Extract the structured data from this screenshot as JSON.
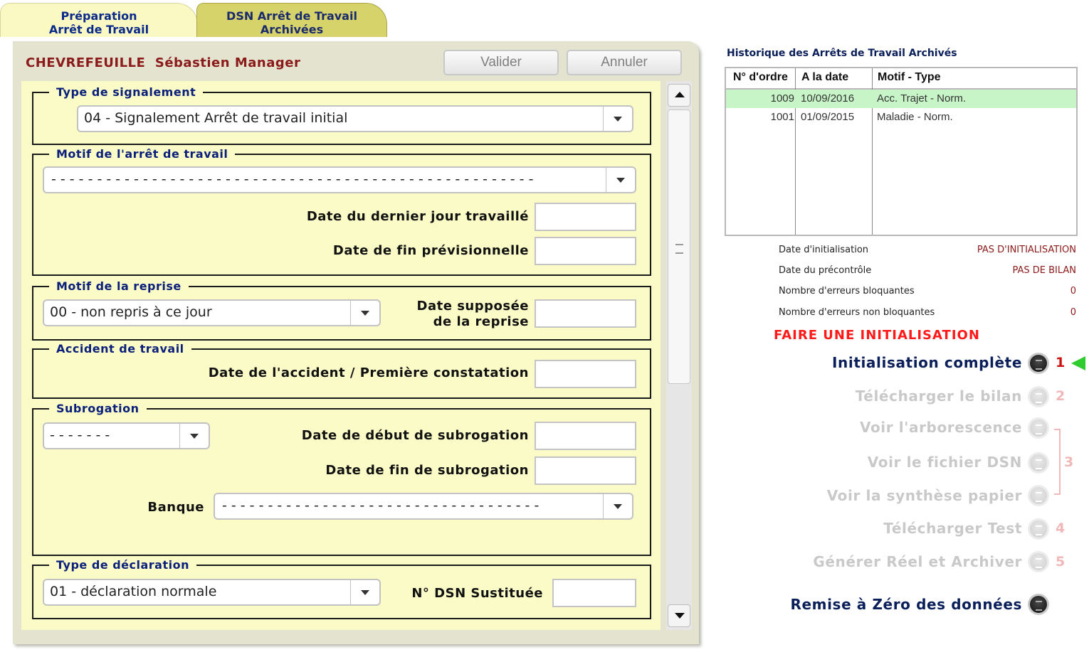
{
  "tabs": [
    {
      "line1": "Préparation",
      "line2": "Arrêt de Travail"
    },
    {
      "line1": "DSN Arrêt de Travail",
      "line2": "Archivées"
    }
  ],
  "employee": {
    "last_name": "CHEVREFEUILLE",
    "first_name": "Sébastien Manager"
  },
  "buttons": {
    "validate": "Valider",
    "cancel": "Annuler"
  },
  "sections": {
    "type_signalement": {
      "legend": "Type de signalement",
      "value": "04 - Signalement Arrêt de travail initial"
    },
    "motif_arret": {
      "legend": "Motif de l'arrêt de travail",
      "value": "- - - - - - - - - - - - - - - - - - - - - - - - - - - - - - - - - - - - - - - - - - - - - - - - - - - - -",
      "date_dernier_jour": "Date du dernier jour travaillé",
      "date_fin_prev": "Date de fin prévisionnelle"
    },
    "motif_reprise": {
      "legend": "Motif de la reprise",
      "value": "00 - non repris à ce jour",
      "date_supposee_1": "Date supposée",
      "date_supposee_2": "de la reprise"
    },
    "accident": {
      "legend": "Accident de travail",
      "date_label": "Date de l'accident / Première constatation"
    },
    "subrogation": {
      "legend": "Subrogation",
      "value": "- - - - - - -",
      "date_debut": "Date de début de subrogation",
      "date_fin": "Date de fin de subrogation",
      "banque": "Banque",
      "banque_value": "- - - - - - - - - - - - - - - - - - - - - - - - - - - - - - - - - - -"
    },
    "type_declaration": {
      "legend": "Type de déclaration",
      "value": "01 - déclaration normale",
      "dsn_label": "N° DSN Sustituée"
    }
  },
  "history": {
    "title": "Historique des Arrêts de Travail Archivés",
    "columns": [
      "N° d'ordre",
      "A la date",
      "Motif - Type"
    ],
    "rows": [
      {
        "num": "1009",
        "date": "10/09/2016",
        "motif": "Acc. Trajet - Norm.",
        "selected": true
      },
      {
        "num": "1001",
        "date": "01/09/2015",
        "motif": "Maladie - Norm.",
        "selected": false
      }
    ]
  },
  "status": [
    {
      "label": "Date d'initialisation",
      "value": "PAS D'INITIALISATION"
    },
    {
      "label": "Date du précontrôle",
      "value": "PAS DE BILAN"
    },
    {
      "label": "Nombre d'erreurs bloquantes",
      "value": "0"
    },
    {
      "label": "Nombre d'erreurs non bloquantes",
      "value": "0"
    }
  ],
  "warning": "FAIRE UNE INITIALISATION",
  "actions": [
    {
      "label": "Initialisation complète",
      "num": "1",
      "enabled": true
    },
    {
      "label": "Télécharger le bilan",
      "num": "2",
      "enabled": false
    },
    {
      "label": "Voir l'arborescence",
      "num": "",
      "enabled": false
    },
    {
      "label": "Voir le fichier DSN",
      "num": "3",
      "enabled": false
    },
    {
      "label": "Voir la synthèse papier",
      "num": "",
      "enabled": false
    },
    {
      "label": "Télécharger Test",
      "num": "4",
      "enabled": false
    },
    {
      "label": "Générer Réel et Archiver",
      "num": "5",
      "enabled": false
    }
  ],
  "reset": "Remise à Zéro des données",
  "colors": {
    "accent_red": "#8b1a1a",
    "navy": "#0a1f5a",
    "disabled": "#c9c9c9",
    "selected_row": "#c8f5c8",
    "arrow_green": "#2ecc2e"
  }
}
